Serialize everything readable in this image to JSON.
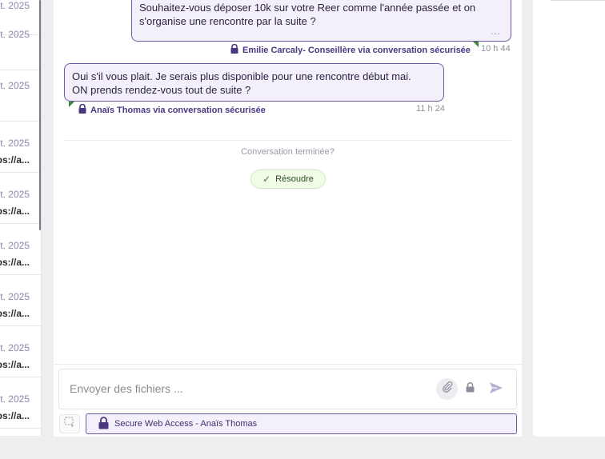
{
  "list": {
    "items": [
      {
        "date": "t. 2025",
        "link": ""
      },
      {
        "date": "t. 2025",
        "link": ""
      },
      {
        "date": "t. 2025",
        "link": "ps://a..."
      },
      {
        "date": "t. 2025",
        "link": "ps://a..."
      },
      {
        "date": "t. 2025",
        "link": "ps://a..."
      },
      {
        "date": "t. 2025",
        "link": "ps://a..."
      },
      {
        "date": "t. 2025",
        "link": "ps://a..."
      },
      {
        "date": "t. 2025",
        "link": "ps://a..."
      }
    ]
  },
  "messages": {
    "outgoing": {
      "text_line1": "Souhaitez-vous déposer 10k sur votre Reer comme l'année passée et on",
      "text_line2": "s'organise une rencontre par la suite ?",
      "more": "...",
      "sender": "Emilie Carcaly- Conseillère via conversation sécurisée",
      "time": "10 h 44"
    },
    "incoming": {
      "text_line1": "Oui s'il vous plait. Je serais plus disponible pour une rencontre début mai.",
      "text_line2": "ON prends rendez-vous tout de suite ?",
      "sender": "Anaïs Thomas via conversation sécurisée",
      "time": "11 h 24"
    }
  },
  "conversation": {
    "ended_label": "Conversation terminée?",
    "resolve_label": "Résoudre"
  },
  "composer": {
    "placeholder": "Envoyer des fichiers ...",
    "channel_label": "Secure Web Access - Anaïs Thomas"
  },
  "colors": {
    "accent": "#4b3781",
    "bubble_bg": "#f4f0fb",
    "bubble_border": "#6f5aa6",
    "resolve_bg": "#f1fbe8"
  }
}
